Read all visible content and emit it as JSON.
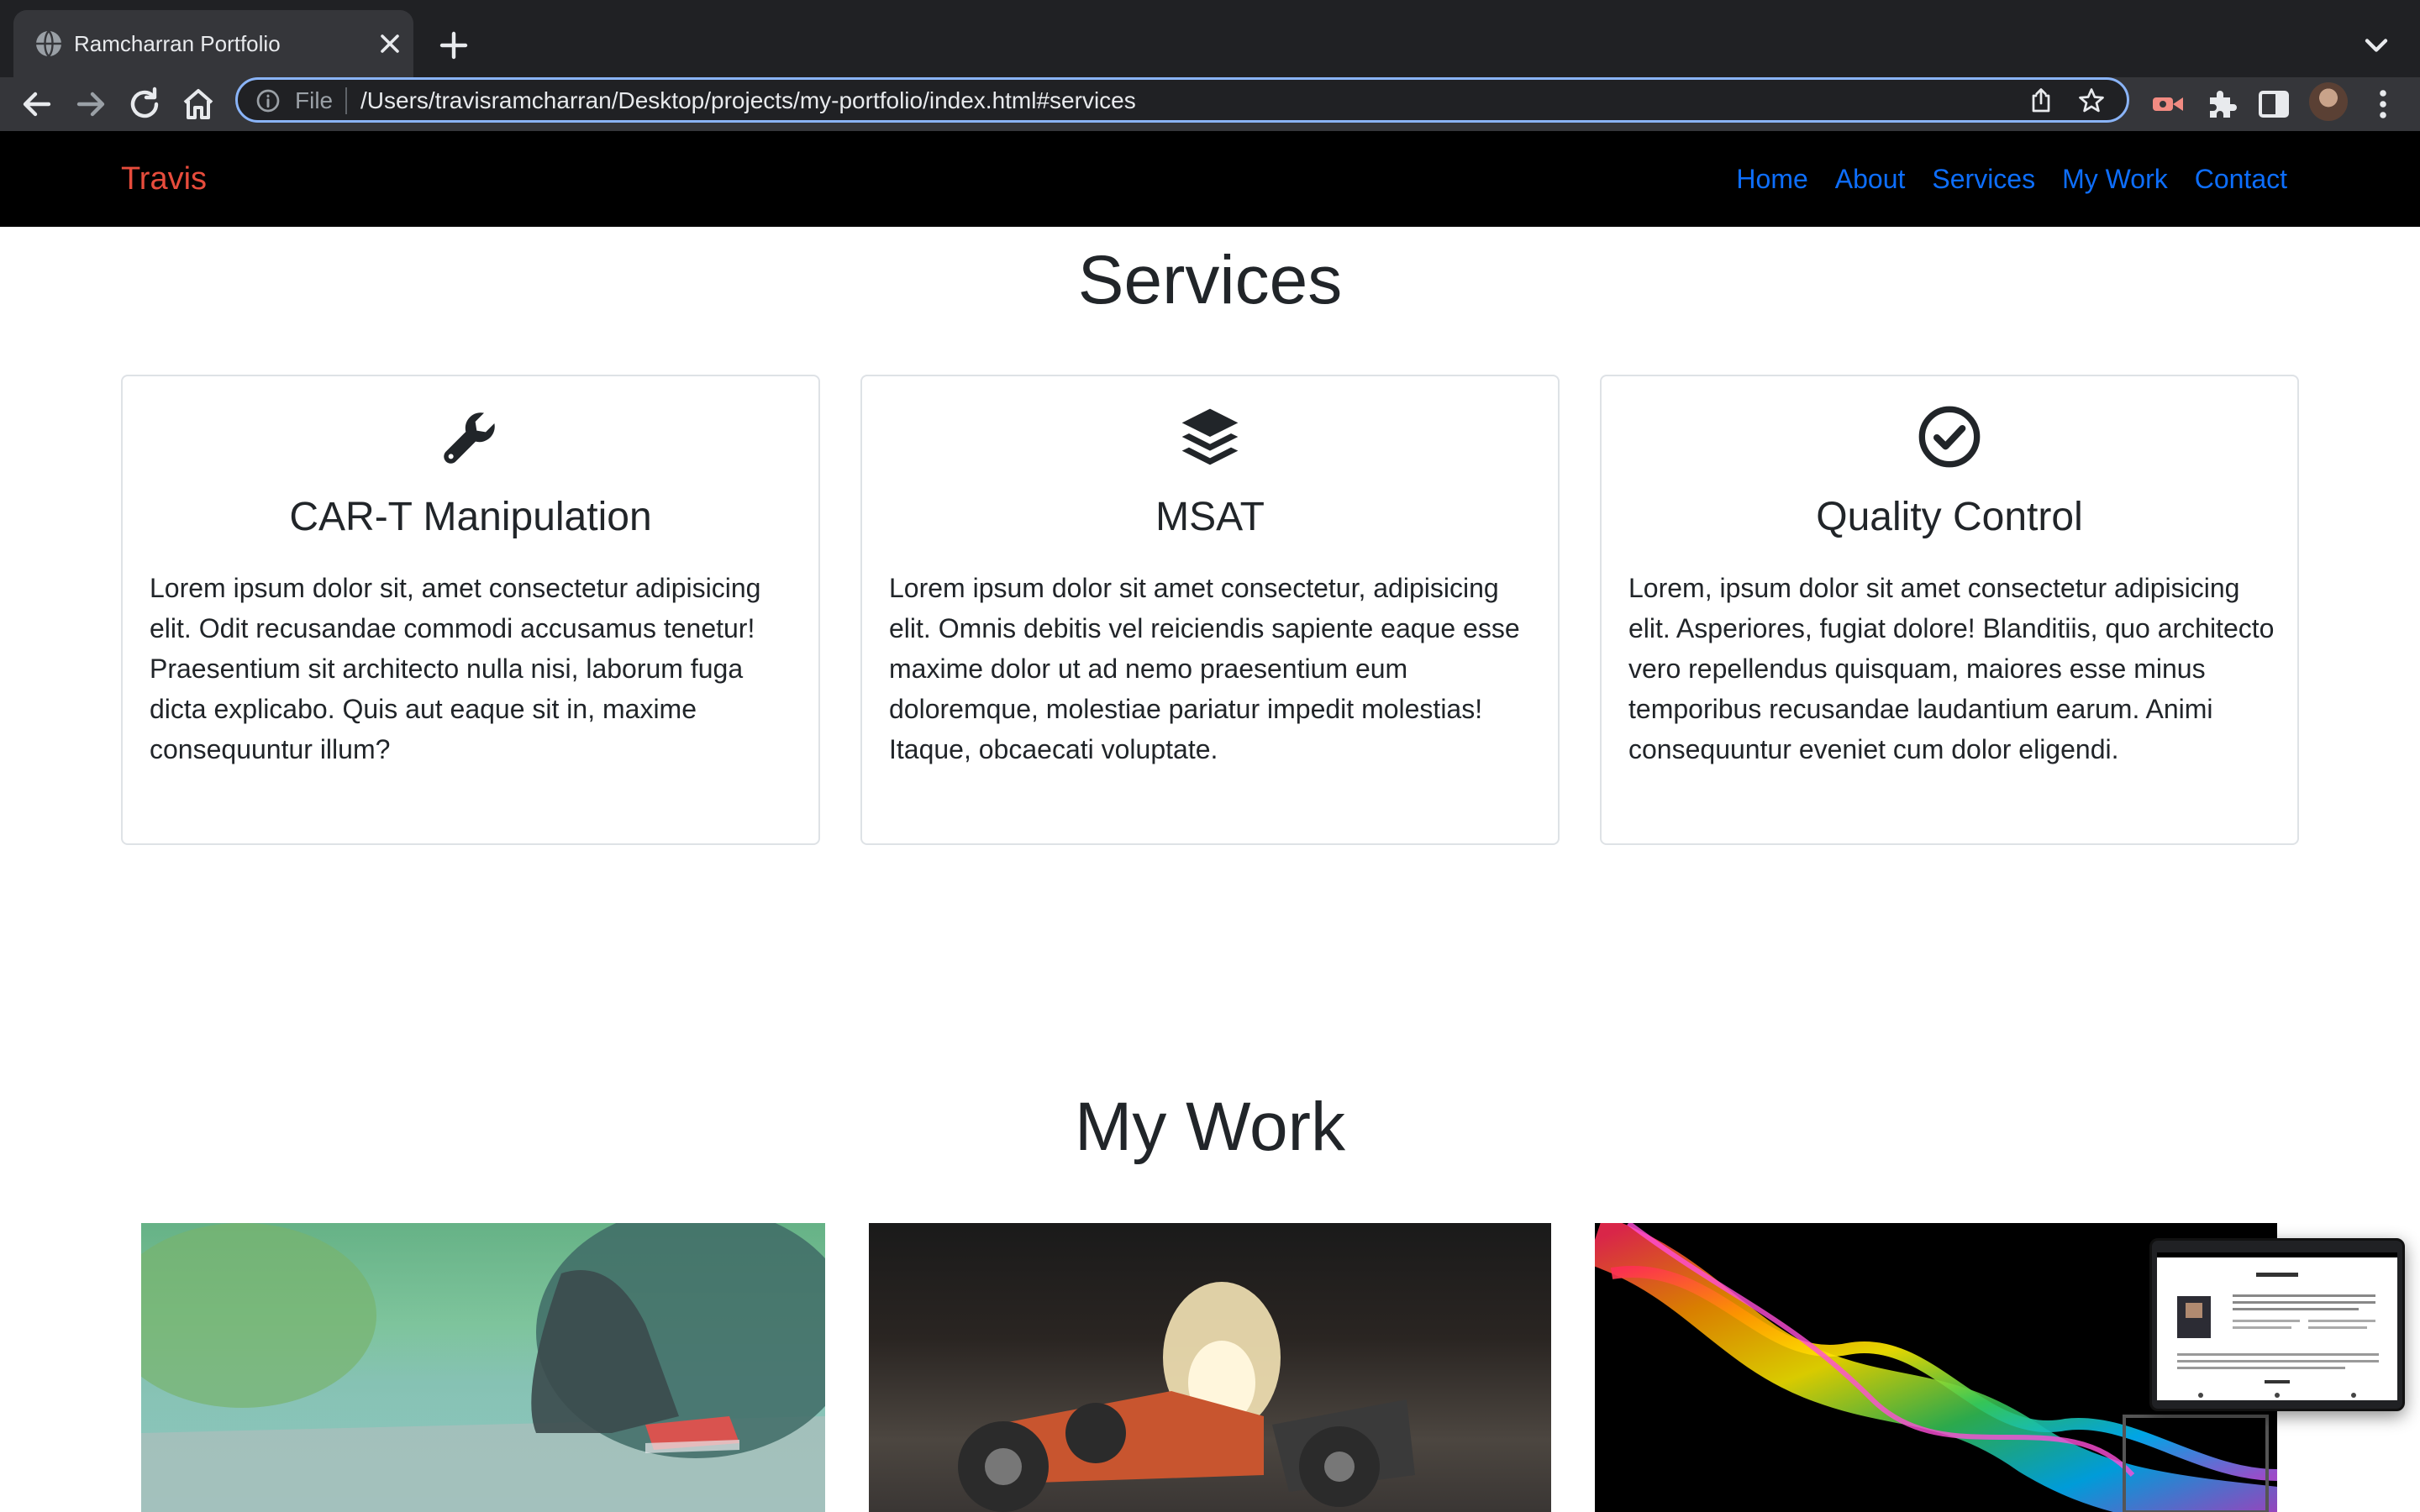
{
  "browser": {
    "tab_title": "Ramcharran Portfolio",
    "omnibox_scheme": "File",
    "url": "/Users/travisramcharran/Desktop/projects/my-portfolio/index.html#services"
  },
  "navbar": {
    "brand": "Travis",
    "links": [
      "Home",
      "About",
      "Services",
      "My Work",
      "Contact"
    ]
  },
  "services": {
    "title": "Services",
    "cards": [
      {
        "icon": "wrench-icon",
        "title": "CAR-T Manipulation",
        "text": "Lorem ipsum dolor sit, amet consectetur adipisicing elit. Odit recusandae commodi accusamus tenetur! Praesentium sit architecto nulla nisi, laborum fuga dicta explicabo. Quis aut eaque sit in, maxime consequuntur illum?"
      },
      {
        "icon": "layers-icon",
        "title": "MSAT",
        "text": "Lorem ipsum dolor sit amet consectetur, adipisicing elit. Omnis debitis vel reiciendis sapiente eaque esse maxime dolor ut ad nemo praesentium eum doloremque, molestiae pariatur impedit molestias! Itaque, obcaecati voluptate."
      },
      {
        "icon": "check-circle-icon",
        "title": "Quality Control",
        "text": "Lorem, ipsum dolor sit amet consectetur adipisicing elit. Asperiores, fugiat dolore! Blanditiis, quo architecto vero repellendus quisquam, maiores esse minus temporibus recusandae laudantium earum. Animi consequuntur eveniet cum dolor eligendi."
      }
    ]
  },
  "work": {
    "title": "My Work"
  },
  "colors": {
    "brand": "#e74c3c",
    "nav_link": "#0d6efd",
    "navbar_bg": "#000000",
    "omnibox_focus": "#8ab4f8"
  }
}
